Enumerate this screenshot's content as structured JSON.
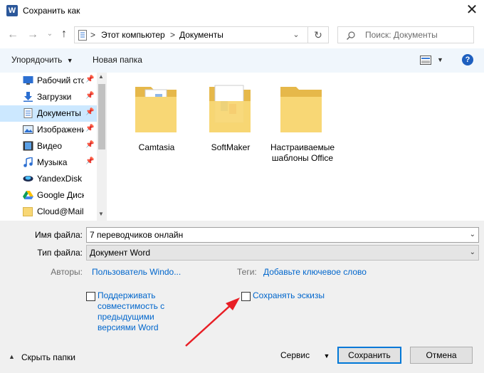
{
  "window": {
    "title": "Сохранить как",
    "app_icon": "W"
  },
  "address": {
    "path": [
      "Этот компьютер",
      "Документы"
    ],
    "separator": ">",
    "search_placeholder": "Поиск: Документы"
  },
  "toolbar": {
    "organize": "Упорядочить",
    "new_folder": "Новая папка",
    "help": "?"
  },
  "sidebar": {
    "items": [
      {
        "label": "Рабочий сто...",
        "icon": "desktop-icon"
      },
      {
        "label": "Загрузки",
        "icon": "download-icon"
      },
      {
        "label": "Документы",
        "icon": "document-icon",
        "selected": true
      },
      {
        "label": "Изображени",
        "icon": "image-icon"
      },
      {
        "label": "Видео",
        "icon": "video-icon"
      },
      {
        "label": "Музыка",
        "icon": "music-icon"
      },
      {
        "label": "YandexDisk",
        "icon": "yandexdisk-icon"
      },
      {
        "label": "Google Диск",
        "icon": "google-drive-icon"
      },
      {
        "label": "Cloud@Mail.",
        "icon": "folder-icon"
      }
    ]
  },
  "folders": [
    {
      "name": "Camtasia"
    },
    {
      "name": "SoftMaker"
    },
    {
      "name": "Настраиваемые шаблоны Office"
    }
  ],
  "form": {
    "filename_label": "Имя файла:",
    "filename_value": "7 переводчиков онлайн",
    "filetype_label": "Тип файла:",
    "filetype_value": "Документ Word",
    "authors_label": "Авторы:",
    "authors_value": "Пользователь Windo...",
    "tags_label": "Теги:",
    "tags_value": "Добавьте ключевое слово",
    "compat_label": "Поддерживать совместимость с предыдущими версиями Word",
    "thumbnails_label": "Сохранять эскизы"
  },
  "footer": {
    "hide_folders": "Скрыть папки",
    "service": "Сервис",
    "save": "Сохранить",
    "cancel": "Отмена"
  },
  "colors": {
    "accent": "#0066cc",
    "arrow": "#e81e25",
    "folder": "#f8d775",
    "toolbar_bg": "#f0f6fc"
  }
}
